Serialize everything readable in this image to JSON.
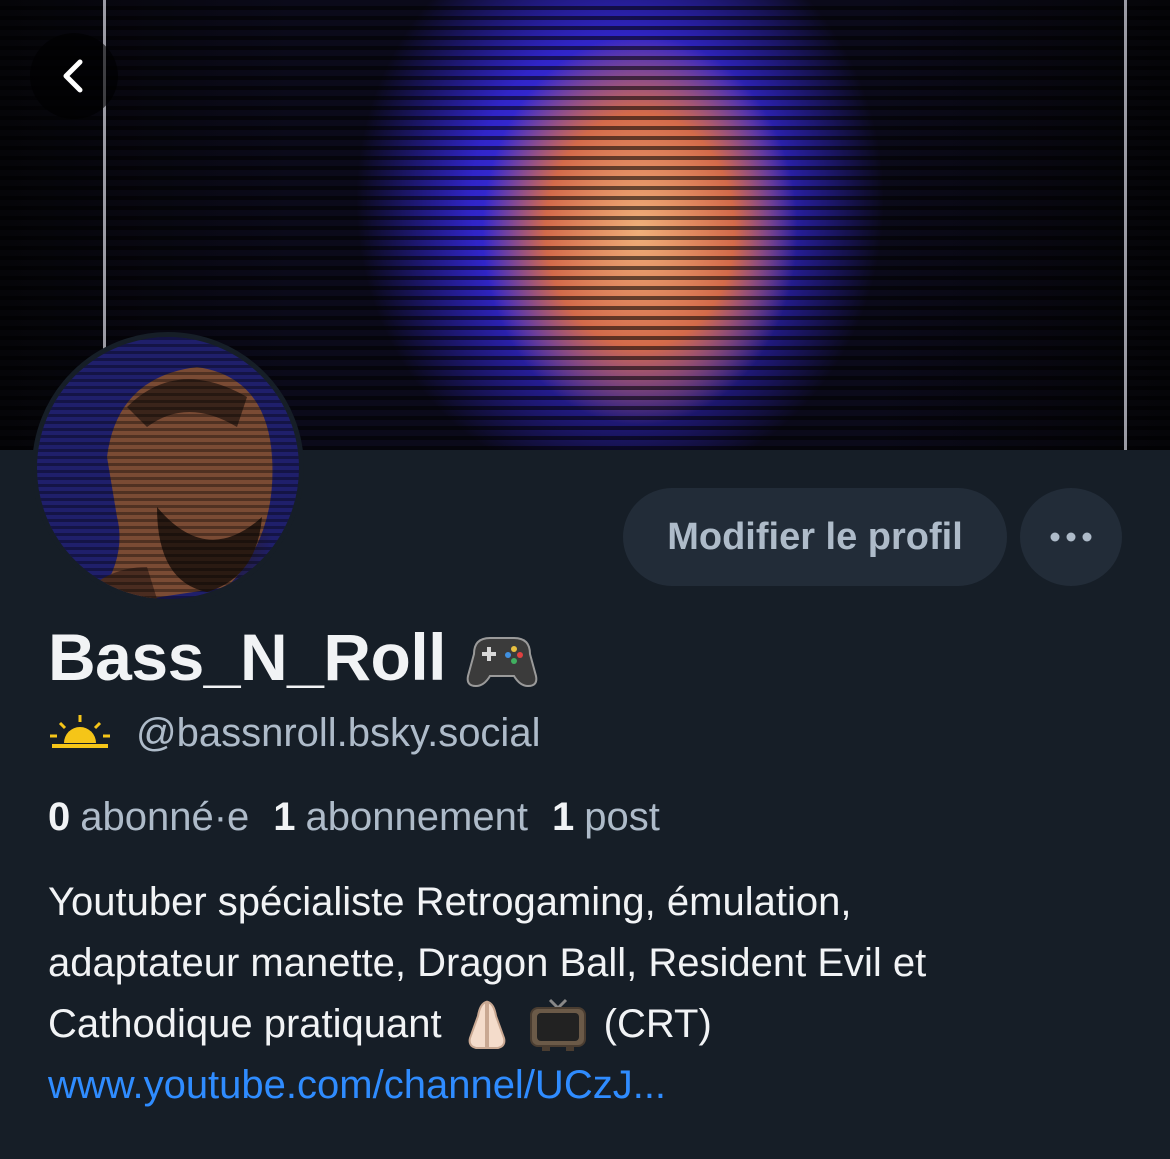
{
  "header": {
    "back_icon": "chevron-left-icon"
  },
  "actions": {
    "edit_profile_label": "Modifier le profil",
    "more_icon": "ellipsis-icon"
  },
  "profile": {
    "display_name": "Bass_N_Roll",
    "display_name_emoji": "gamepad-icon",
    "handle_emoji": "sunrise-icon",
    "handle": "@bassnroll.bsky.social"
  },
  "stats": {
    "followers_count": "0",
    "followers_label": "abonné·e",
    "following_count": "1",
    "following_label": "abonnement",
    "posts_count": "1",
    "posts_label": "post"
  },
  "bio": {
    "line1": "Youtuber spécialiste Retrogaming, émulation,",
    "line2": "adaptateur manette, Dragon Ball, Resident Evil et",
    "line3_text": "Cathodique pratiquant",
    "line3_emoji_1": "praying-hands-icon",
    "line3_emoji_2": "television-icon",
    "line3_suffix": "(CRT)",
    "link": "www.youtube.com/channel/UCzJ..."
  },
  "colors": {
    "background": "#161e27",
    "button_bg": "#222c38",
    "secondary_text": "#aebbc9",
    "link": "#2f8cff"
  }
}
